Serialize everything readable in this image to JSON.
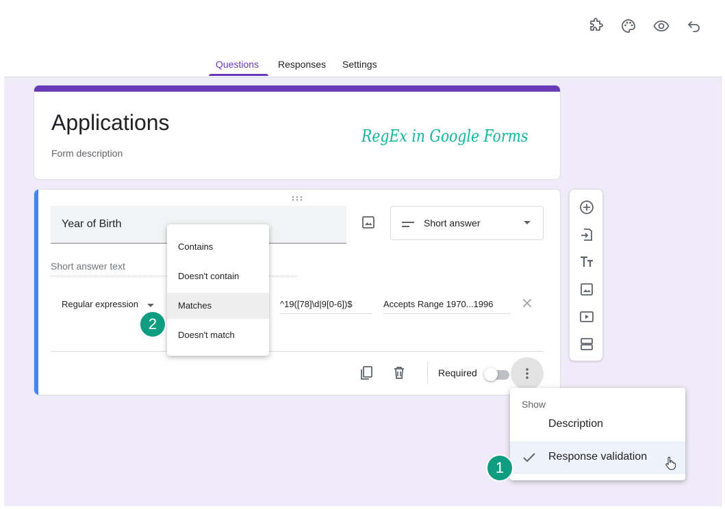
{
  "tabs": [
    {
      "label": "Questions",
      "active": true
    },
    {
      "label": "Responses",
      "active": false
    },
    {
      "label": "Settings",
      "active": false
    }
  ],
  "top_icons": [
    "puzzle-icon",
    "palette-icon",
    "eye-icon",
    "undo-icon"
  ],
  "form": {
    "title": "Applications",
    "description_placeholder": "Form description",
    "overlay_caption": "RegEx in Google Forms"
  },
  "question": {
    "title": "Year of Birth",
    "type_label": "Short answer",
    "answer_placeholder": "Short answer text",
    "validation_type": "Regular expression",
    "pattern": "^19([78]\\d|9[0-6])$",
    "error_text": "Accepts Range 1970...1996",
    "required_label": "Required"
  },
  "condition_menu": {
    "items": [
      "Contains",
      "Doesn't contain",
      "Matches",
      "Doesn't match"
    ],
    "selected": "Matches"
  },
  "show_menu": {
    "header": "Show",
    "items": [
      {
        "label": "Description",
        "checked": false
      },
      {
        "label": "Response validation",
        "checked": true
      }
    ]
  },
  "badges": {
    "one": "1",
    "two": "2"
  },
  "colors": {
    "accent": "#673ab7",
    "question_accent": "#4285f4",
    "badge": "#0f9d82",
    "caption": "#12b59c",
    "background": "#efebf8"
  }
}
